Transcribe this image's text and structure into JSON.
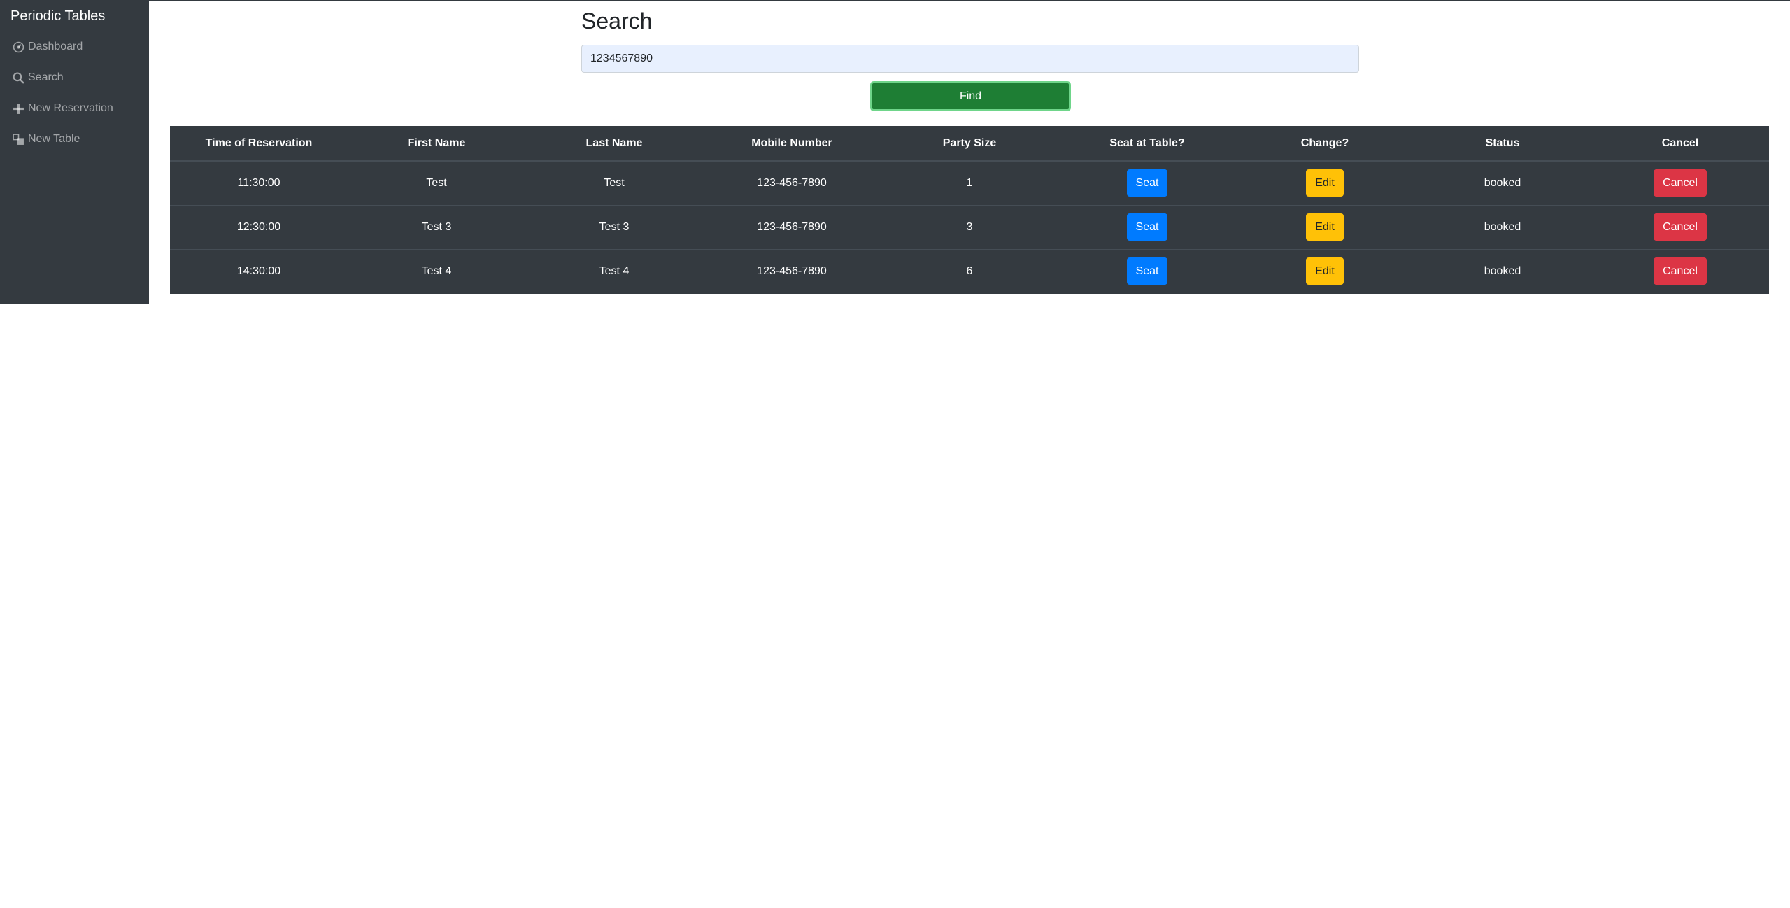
{
  "app": {
    "brand": "Periodic Tables"
  },
  "sidebar": {
    "items": [
      {
        "label": "Dashboard",
        "icon": "dashboard-icon"
      },
      {
        "label": "Search",
        "icon": "search-icon"
      },
      {
        "label": "New Reservation",
        "icon": "plus-icon"
      },
      {
        "label": "New Table",
        "icon": "table-icon"
      }
    ]
  },
  "search": {
    "title": "Search",
    "value": "1234567890",
    "placeholder": "",
    "find_label": "Find"
  },
  "table": {
    "headers": [
      "Time of Reservation",
      "First Name",
      "Last Name",
      "Mobile Number",
      "Party Size",
      "Seat at Table?",
      "Change?",
      "Status",
      "Cancel"
    ],
    "rows": [
      {
        "time": "11:30:00",
        "first": "Test",
        "last": "Test",
        "mobile": "123-456-7890",
        "party": "1",
        "seat": "Seat",
        "edit": "Edit",
        "status": "booked",
        "cancel": "Cancel"
      },
      {
        "time": "12:30:00",
        "first": "Test 3",
        "last": "Test 3",
        "mobile": "123-456-7890",
        "party": "3",
        "seat": "Seat",
        "edit": "Edit",
        "status": "booked",
        "cancel": "Cancel"
      },
      {
        "time": "14:30:00",
        "first": "Test 4",
        "last": "Test 4",
        "mobile": "123-456-7890",
        "party": "6",
        "seat": "Seat",
        "edit": "Edit",
        "status": "booked",
        "cancel": "Cancel"
      }
    ]
  },
  "colors": {
    "sidebar_bg": "#343a40",
    "find_button": "#1e7e34",
    "seat_button": "#007bff",
    "edit_button": "#ffc107",
    "cancel_button": "#dc3545"
  }
}
